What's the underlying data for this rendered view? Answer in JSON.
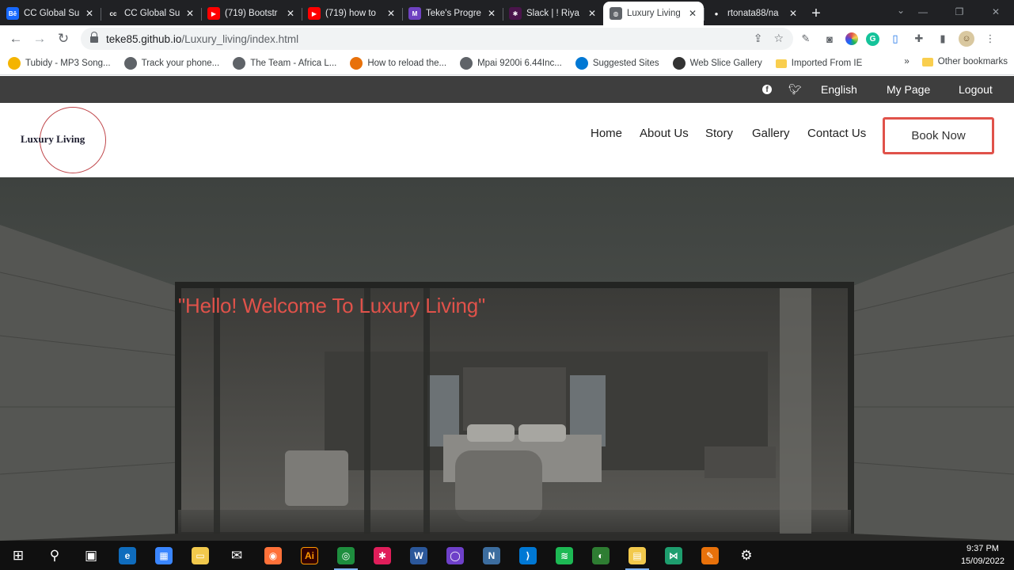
{
  "browser": {
    "tabs": [
      {
        "title": "CC Global Su",
        "favicon": "behance-icon",
        "color": "#1769ff",
        "glyph": "Bē",
        "active": false
      },
      {
        "title": "CC Global Su",
        "favicon": "cc-icon",
        "color": "#202124",
        "glyph": "cc",
        "active": false
      },
      {
        "title": "(719) Bootstr",
        "favicon": "youtube-icon",
        "color": "#ff0000",
        "glyph": "▶",
        "active": false
      },
      {
        "title": "(719) how to",
        "favicon": "youtube-icon",
        "color": "#ff0000",
        "glyph": "▶",
        "active": false
      },
      {
        "title": "Teke's Progre",
        "favicon": "microverse-icon",
        "color": "#6f42c1",
        "glyph": "M",
        "active": false
      },
      {
        "title": "Slack | ! Riya",
        "favicon": "slack-icon",
        "color": "#4a154b",
        "glyph": "✱",
        "active": false
      },
      {
        "title": "Luxury Living",
        "favicon": "globe-icon",
        "color": "#5f6368",
        "glyph": "◍",
        "active": true
      },
      {
        "title": "rtonata88/na",
        "favicon": "github-icon",
        "color": "#202124",
        "glyph": "●",
        "active": false
      }
    ],
    "new_tab": "+",
    "url_host": "teke85.github.io",
    "url_path": "/Luxury_living/index.html",
    "bookmarks": [
      {
        "label": "Tubidy - MP3 Song...",
        "icon": "tubidy-icon",
        "color": "#f4b400"
      },
      {
        "label": "Track your phone...",
        "icon": "globe-icon",
        "color": "#5f6368"
      },
      {
        "label": "The Team - Africa L...",
        "icon": "globe-icon",
        "color": "#5f6368"
      },
      {
        "label": "How to reload the...",
        "icon": "c3-icon",
        "color": "#e8710a"
      },
      {
        "label": "Mpai 9200i 6.44Inc...",
        "icon": "globe-icon",
        "color": "#5f6368"
      },
      {
        "label": "Suggested Sites",
        "icon": "bing-icon",
        "color": "#0078d4"
      },
      {
        "label": "Web Slice Gallery",
        "icon": "webslice-icon",
        "color": "#333333"
      },
      {
        "label": "Imported From IE",
        "icon": "folder-icon",
        "color": "#f9ce4e"
      }
    ],
    "more_bookmarks": "»",
    "other_bookmarks": "Other bookmarks"
  },
  "site": {
    "topbar": {
      "language": "English",
      "my_page": "My Page",
      "logout": "Logout"
    },
    "logo": "Luxury Living",
    "nav": [
      "Home",
      "About Us",
      "Story",
      "Gallery",
      "Contact Us"
    ],
    "book_now": "Book Now",
    "hero_heading": "\"Hello! Welcome To Luxury Living\"",
    "colors": {
      "accent": "#e0524a",
      "topbar": "#3e3e3e",
      "logo_ring": "#c0474b"
    }
  },
  "taskbar": {
    "apps": [
      {
        "icon": "windows-start-icon",
        "glyph": "⊞",
        "color": "transparent"
      },
      {
        "icon": "search-icon",
        "glyph": "⚲",
        "color": "transparent"
      },
      {
        "icon": "task-view-icon",
        "glyph": "▣",
        "color": "transparent"
      },
      {
        "icon": "edge-icon",
        "glyph": "e",
        "color": "#0f6cbd"
      },
      {
        "icon": "store-icon",
        "glyph": "▦",
        "color": "#3a86ff"
      },
      {
        "icon": "file-explorer-icon",
        "glyph": "▭",
        "color": "#f2c94c"
      },
      {
        "icon": "mail-icon",
        "glyph": "✉",
        "color": "transparent"
      },
      {
        "icon": "firefox-icon",
        "glyph": "◉",
        "color": "#ff7139"
      },
      {
        "icon": "illustrator-icon",
        "glyph": "Ai",
        "color": "#330000"
      },
      {
        "icon": "chrome-icon",
        "glyph": "◎",
        "color": "#1e8e3e"
      },
      {
        "icon": "slack-icon",
        "glyph": "✱",
        "color": "#e01e5a"
      },
      {
        "icon": "word-icon",
        "glyph": "W",
        "color": "#2b579a"
      },
      {
        "icon": "github-desktop-icon",
        "glyph": "◯",
        "color": "#6e40c9"
      },
      {
        "icon": "notion-icon",
        "glyph": "N",
        "color": "#3c6d9f"
      },
      {
        "icon": "vscode-icon",
        "glyph": "⟩",
        "color": "#0078d4"
      },
      {
        "icon": "spotify-icon",
        "glyph": "≋",
        "color": "#1db954"
      },
      {
        "icon": "app-globe-icon",
        "glyph": "◐",
        "color": "#2e7d32"
      },
      {
        "icon": "sticky-notes-icon",
        "glyph": "▤",
        "color": "#f2c94c"
      },
      {
        "icon": "visual-studio-icon",
        "glyph": "⋈",
        "color": "#1e9e6e"
      },
      {
        "icon": "paint-icon",
        "glyph": "✎",
        "color": "#e8710a"
      },
      {
        "icon": "settings-icon",
        "glyph": "⚙",
        "color": "transparent"
      }
    ],
    "time": "9:37 PM",
    "date": "15/09/2022"
  }
}
